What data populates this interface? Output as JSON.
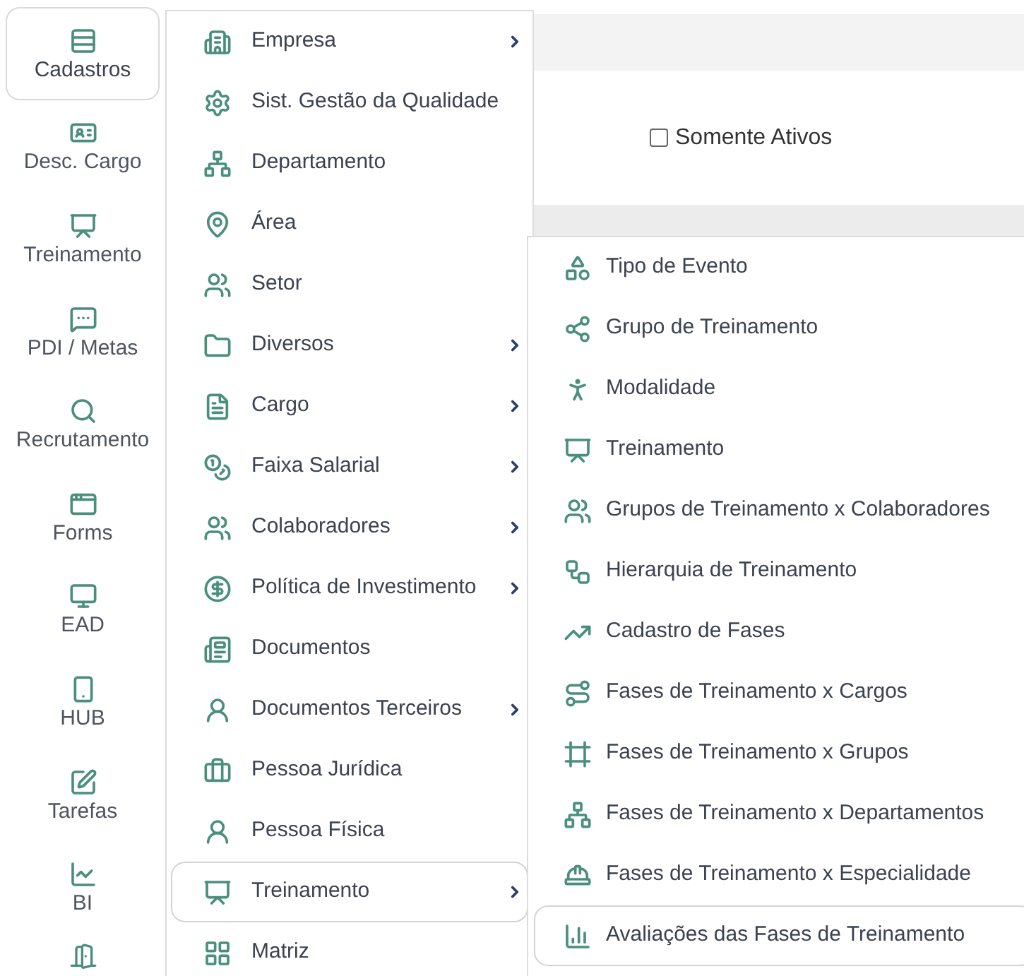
{
  "sidebar": {
    "items": [
      {
        "label": "Cadastros",
        "selected": true
      },
      {
        "label": "Desc. Cargo",
        "selected": false
      },
      {
        "label": "Treinamento",
        "selected": false
      },
      {
        "label": "PDI / Metas",
        "selected": false
      },
      {
        "label": "Recrutamento",
        "selected": false
      },
      {
        "label": "Forms",
        "selected": false
      },
      {
        "label": "EAD",
        "selected": false
      },
      {
        "label": "HUB",
        "selected": false
      },
      {
        "label": "Tarefas",
        "selected": false
      },
      {
        "label": "BI",
        "selected": false
      }
    ]
  },
  "filter": {
    "label": "Somente Ativos",
    "checked": false
  },
  "menu": {
    "items": [
      {
        "label": "Empresa",
        "has_submenu": true,
        "selected": false
      },
      {
        "label": "Sist. Gestão da Qualidade",
        "has_submenu": false,
        "selected": false
      },
      {
        "label": "Departamento",
        "has_submenu": false,
        "selected": false
      },
      {
        "label": "Área",
        "has_submenu": false,
        "selected": false
      },
      {
        "label": "Setor",
        "has_submenu": false,
        "selected": false
      },
      {
        "label": "Diversos",
        "has_submenu": true,
        "selected": false
      },
      {
        "label": "Cargo",
        "has_submenu": true,
        "selected": false
      },
      {
        "label": "Faixa Salarial",
        "has_submenu": true,
        "selected": false
      },
      {
        "label": "Colaboradores",
        "has_submenu": true,
        "selected": false
      },
      {
        "label": "Política de Investimento",
        "has_submenu": true,
        "selected": false
      },
      {
        "label": "Documentos",
        "has_submenu": false,
        "selected": false
      },
      {
        "label": "Documentos Terceiros",
        "has_submenu": true,
        "selected": false
      },
      {
        "label": "Pessoa Jurídica",
        "has_submenu": false,
        "selected": false
      },
      {
        "label": "Pessoa Física",
        "has_submenu": false,
        "selected": false
      },
      {
        "label": "Treinamento",
        "has_submenu": true,
        "selected": true
      },
      {
        "label": "Matriz",
        "has_submenu": false,
        "selected": false
      }
    ]
  },
  "submenu": {
    "items": [
      {
        "label": "Tipo de Evento",
        "selected": false
      },
      {
        "label": "Grupo de Treinamento",
        "selected": false
      },
      {
        "label": "Modalidade",
        "selected": false
      },
      {
        "label": "Treinamento",
        "selected": false
      },
      {
        "label": "Grupos de Treinamento x Colaboradores",
        "selected": false
      },
      {
        "label": "Hierarquia de Treinamento",
        "selected": false
      },
      {
        "label": "Cadastro de Fases",
        "selected": false
      },
      {
        "label": "Fases de Treinamento x Cargos",
        "selected": false
      },
      {
        "label": "Fases de Treinamento x Grupos",
        "selected": false
      },
      {
        "label": "Fases de Treinamento x Departamentos",
        "selected": false
      },
      {
        "label": "Fases de Treinamento x Especialidade",
        "selected": false
      },
      {
        "label": "Avaliações das Fases de Treinamento",
        "selected": true
      }
    ]
  }
}
